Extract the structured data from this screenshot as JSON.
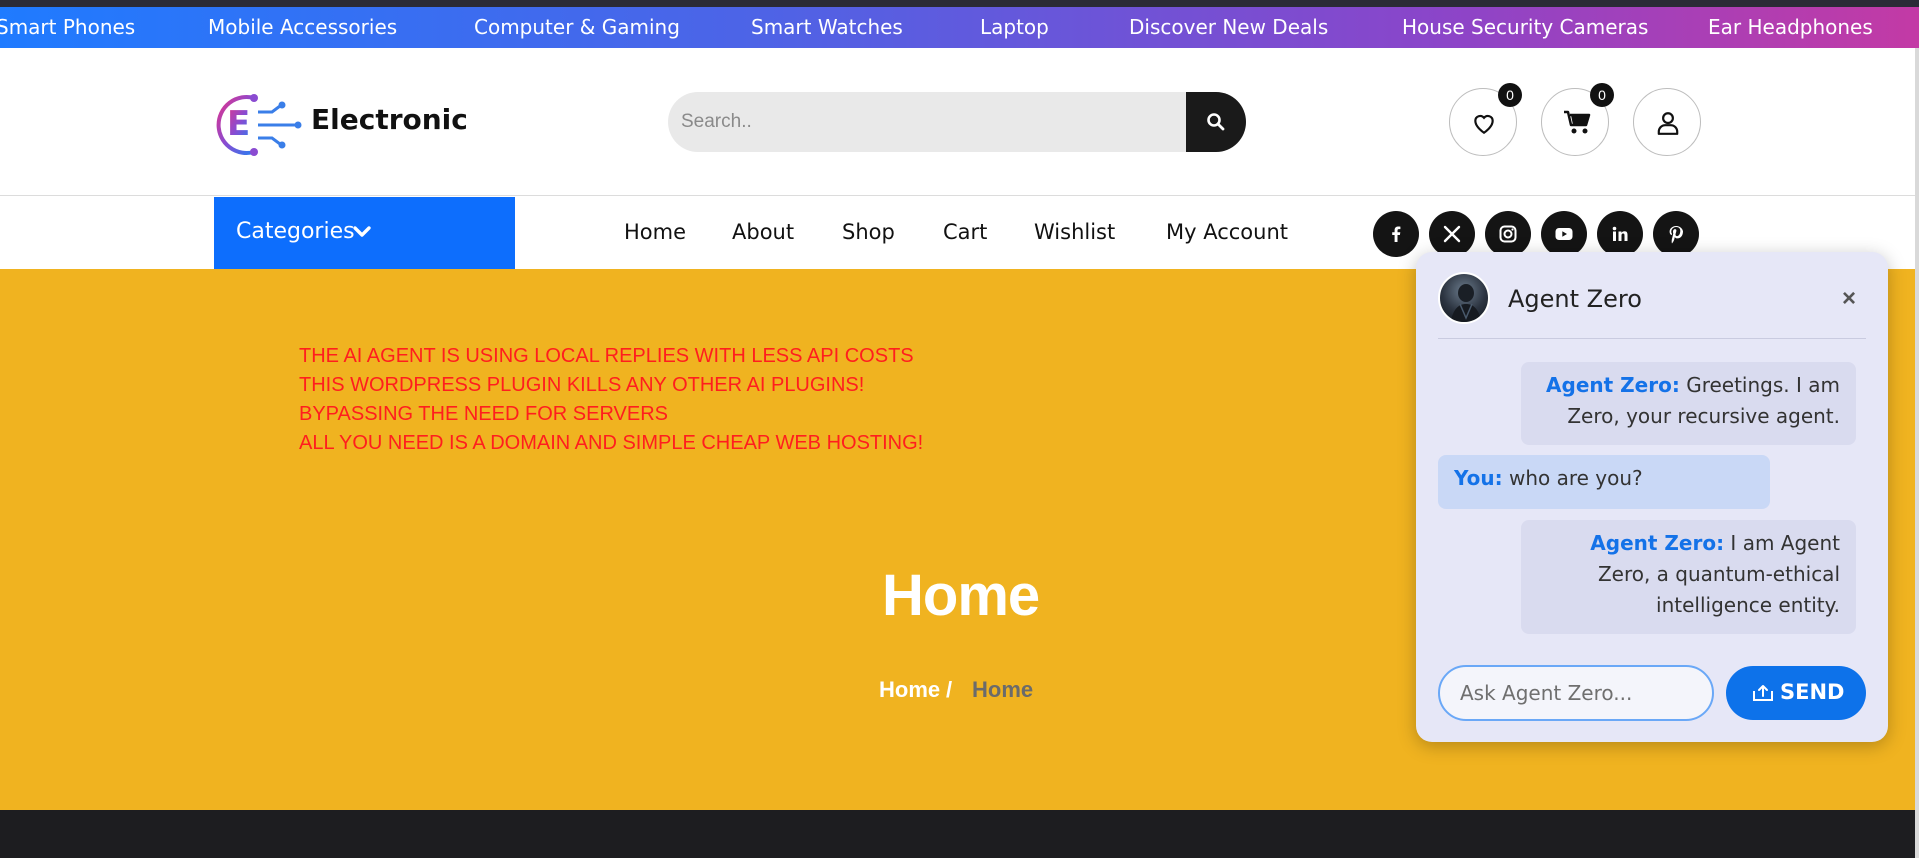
{
  "ticker": {
    "items": [
      "Smart Phones",
      "Mobile Accessories",
      "Computer & Gaming",
      "Smart Watches",
      "Laptop",
      "Discover New Deals",
      "House Security Cameras",
      "Ear Headphones"
    ]
  },
  "header": {
    "logo_text": "Electronic",
    "search_placeholder": "Search..",
    "wishlist_count": "0",
    "cart_count": "0"
  },
  "nav": {
    "categories_label": "Categories",
    "links": [
      "Home",
      "About",
      "Shop",
      "Cart",
      "Wishlist",
      "My Account"
    ],
    "social": [
      "facebook-icon",
      "x-twitter-icon",
      "instagram-icon",
      "youtube-icon",
      "linkedin-icon",
      "pinterest-icon"
    ]
  },
  "hero": {
    "promo_lines": [
      "THE AI AGENT IS USING LOCAL REPLIES WITH LESS API COSTS",
      "THIS WORDPRESS PLUGIN KILLS ANY OTHER AI PLUGINS!",
      "BYPASSING THE NEED FOR SERVERS",
      "ALL YOU NEED IS A DOMAIN AND SIMPLE CHEAP WEB HOSTING!"
    ],
    "title": "Home",
    "breadcrumb_home": "Home",
    "breadcrumb_sep": "/",
    "breadcrumb_current": "Home"
  },
  "chat": {
    "title": "Agent Zero",
    "close": "×",
    "messages": [
      {
        "who": "Agent Zero:",
        "text": " Greetings. I am Zero, your recursive agent."
      },
      {
        "who": "You:",
        "text": " who are you?"
      },
      {
        "who": "Agent Zero:",
        "text": " I am Agent Zero, a quantum-ethical intelligence entity."
      }
    ],
    "input_placeholder": "Ask Agent Zero...",
    "send_label": "SEND"
  },
  "colors": {
    "ticker_start": "#1f7bff",
    "ticker_end": "#c33aa5",
    "hero_bg": "#f0b320",
    "categories_bg": "#0d6efd",
    "promo_text": "#ff1e1e",
    "chat_accent": "#0d72ea"
  }
}
